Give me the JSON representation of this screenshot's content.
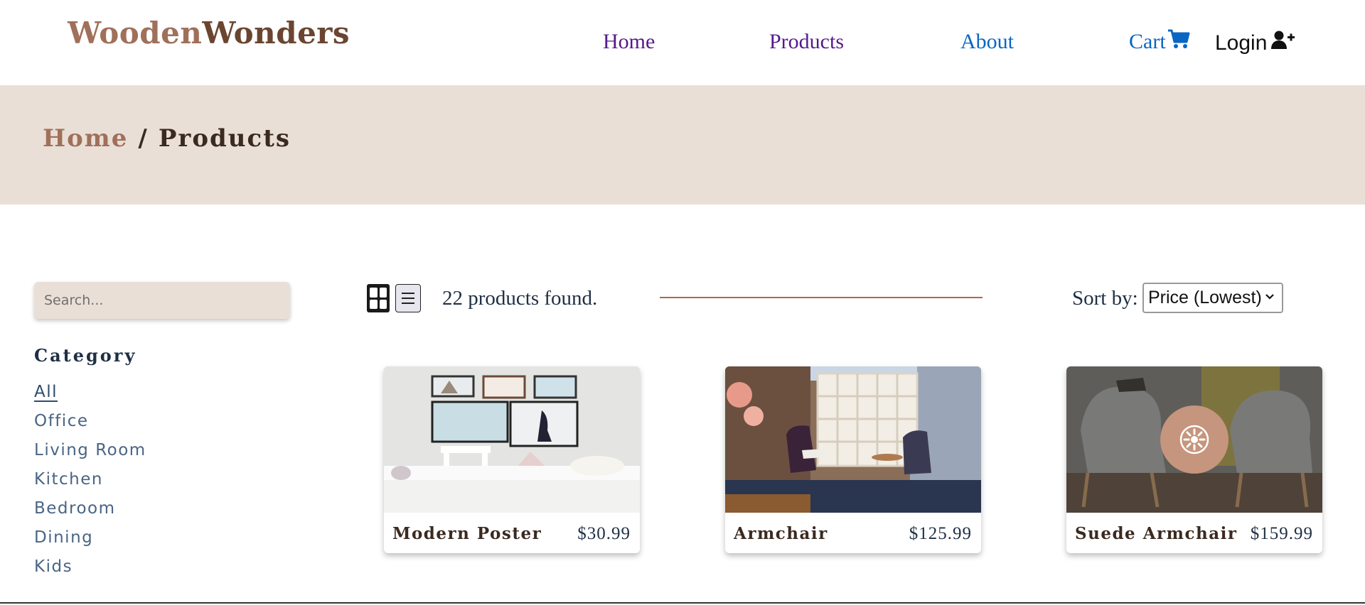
{
  "header": {
    "logo_part1": "Wooden",
    "logo_part2": "Wonders",
    "nav": {
      "home": "Home",
      "products": "Products",
      "about": "About",
      "cart": "Cart",
      "login": "Login"
    },
    "icons": {
      "cart": "cart-icon",
      "login": "user-plus-icon"
    }
  },
  "breadcrumb": {
    "home": "Home",
    "separator": "/",
    "current": "Products"
  },
  "sidebar": {
    "search_placeholder": "Search...",
    "category_title": "Category",
    "categories": [
      "All",
      "Office",
      "Living Room",
      "Kitchen",
      "Bedroom",
      "Dining",
      "Kids"
    ],
    "active_category": "All"
  },
  "toolbar": {
    "count_text": "22 products found.",
    "sort_label": "Sort by:",
    "sort_selected": "Price (Lowest)",
    "active_view": "grid"
  },
  "products": [
    {
      "name": "Modern Poster",
      "price": "$30.99"
    },
    {
      "name": "Armchair",
      "price": "$125.99"
    },
    {
      "name": "Suede Armchair",
      "price": "$159.99"
    }
  ],
  "colors": {
    "brand_light": "#a0705a",
    "brand_dark": "#6b4530",
    "band_bg": "#eadfd7",
    "accent_line": "#b5654a",
    "text_navy": "#1f2f45"
  }
}
